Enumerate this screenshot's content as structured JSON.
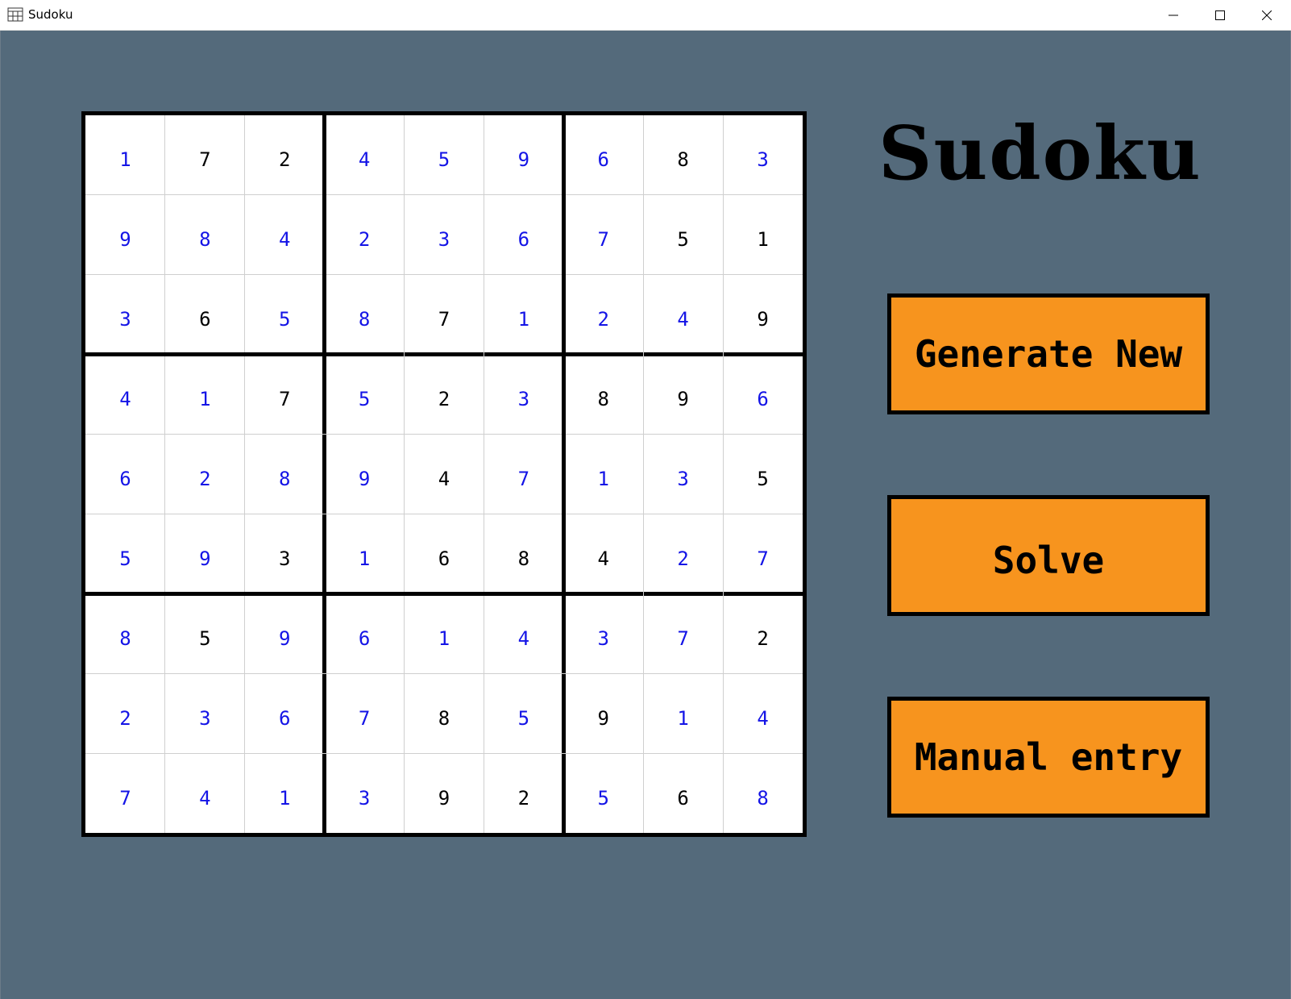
{
  "window": {
    "title": "Sudoku"
  },
  "logo": "Sudoku",
  "buttons": {
    "generate": "Generate New",
    "solve": "Solve",
    "manual": "Manual entry"
  },
  "colors": {
    "background": "#546a7b",
    "button": "#f7941e",
    "given_digit": "#000000",
    "solved_digit": "#1414e6"
  },
  "grid": [
    [
      "1",
      "7",
      "2",
      "4",
      "5",
      "9",
      "6",
      "8",
      "3"
    ],
    [
      "9",
      "8",
      "4",
      "2",
      "3",
      "6",
      "7",
      "5",
      "1"
    ],
    [
      "3",
      "6",
      "5",
      "8",
      "7",
      "1",
      "2",
      "4",
      "9"
    ],
    [
      "4",
      "1",
      "7",
      "5",
      "2",
      "3",
      "8",
      "9",
      "6"
    ],
    [
      "6",
      "2",
      "8",
      "9",
      "4",
      "7",
      "1",
      "3",
      "5"
    ],
    [
      "5",
      "9",
      "3",
      "1",
      "6",
      "8",
      "4",
      "2",
      "7"
    ],
    [
      "8",
      "5",
      "9",
      "6",
      "1",
      "4",
      "3",
      "7",
      "2"
    ],
    [
      "2",
      "3",
      "6",
      "7",
      "8",
      "5",
      "9",
      "1",
      "4"
    ],
    [
      "7",
      "4",
      "1",
      "3",
      "9",
      "2",
      "5",
      "6",
      "8"
    ]
  ],
  "solved_mask": [
    [
      1,
      0,
      0,
      1,
      1,
      1,
      1,
      0,
      1
    ],
    [
      1,
      1,
      1,
      1,
      1,
      1,
      1,
      0,
      0
    ],
    [
      1,
      0,
      1,
      1,
      0,
      1,
      1,
      1,
      0
    ],
    [
      1,
      1,
      0,
      1,
      0,
      1,
      0,
      0,
      1
    ],
    [
      1,
      1,
      1,
      1,
      0,
      1,
      1,
      1,
      0
    ],
    [
      1,
      1,
      0,
      1,
      0,
      0,
      0,
      1,
      1
    ],
    [
      1,
      0,
      1,
      1,
      1,
      1,
      1,
      1,
      0
    ],
    [
      1,
      1,
      1,
      1,
      0,
      1,
      0,
      1,
      1
    ],
    [
      1,
      1,
      1,
      1,
      0,
      0,
      1,
      0,
      1
    ]
  ]
}
